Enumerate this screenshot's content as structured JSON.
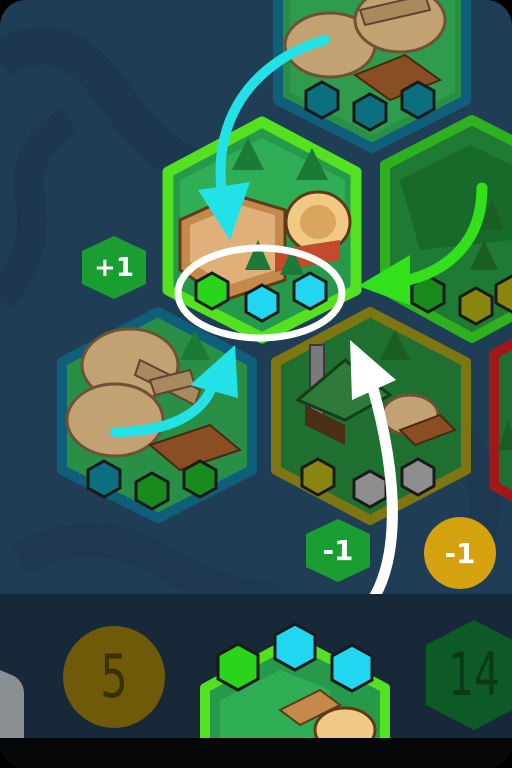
{
  "board": {
    "tiles": [
      {
        "name": "top-lumber-tile",
        "border": "#0f5f7a"
      },
      {
        "name": "selected-forest-sawmill-tile",
        "border": "#53e121"
      },
      {
        "name": "right-forest-tile",
        "border": "#2fb01e"
      },
      {
        "name": "left-lumber-tile",
        "border": "#0f5f7a"
      },
      {
        "name": "center-forest-tower-tile",
        "border": "#7e7612"
      },
      {
        "name": "far-right-tile",
        "border": "#a01818"
      }
    ],
    "slot_colors": {
      "blue": "#22d6f2",
      "teal": "#0b6f80",
      "green": "#2bd41c",
      "dark_green": "#188a1e",
      "olive": "#8a8612",
      "gray": "#8e8e8e"
    }
  },
  "badges": {
    "plus_one": {
      "text": "+1",
      "color": "#1a9e32"
    },
    "minus_one_green": {
      "text": "-1",
      "color": "#1a9e32"
    },
    "minus_one_gold": {
      "text": "-1",
      "color": "#d3a20e"
    }
  },
  "arrows": {
    "cyan": "#22e2e8",
    "green": "#33e01c",
    "white": "#ffffff"
  },
  "footer": {
    "left_counter": {
      "text": "5",
      "color": "#6e5a08"
    },
    "right_counter": {
      "text": "14",
      "color": "#0e5a26"
    }
  }
}
